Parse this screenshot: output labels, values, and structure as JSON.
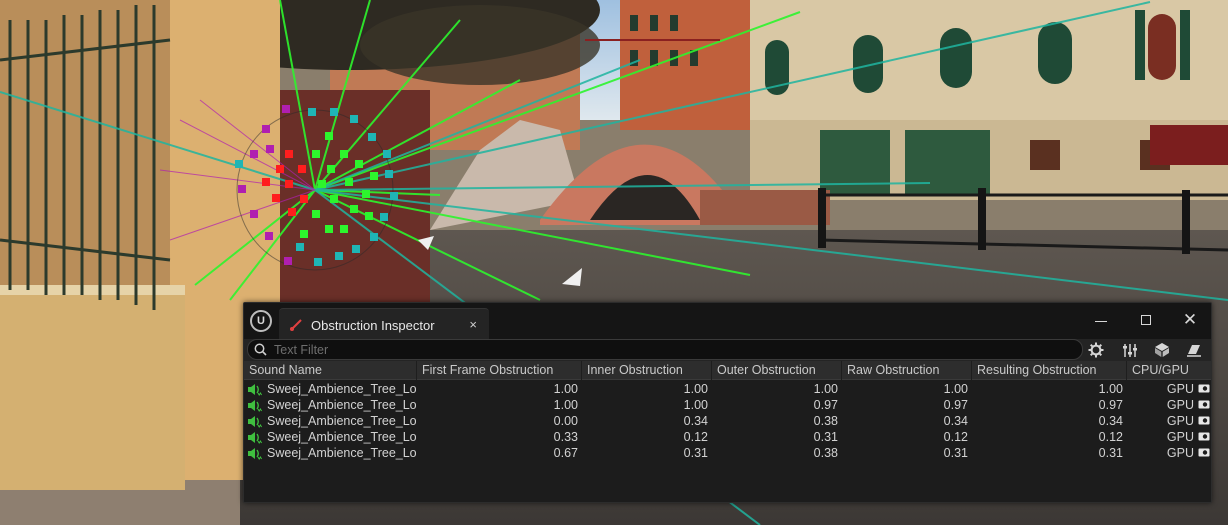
{
  "window": {
    "title": "Obstruction Inspector",
    "tab_close": "×",
    "logo": "U",
    "controls": {
      "close": "✕"
    }
  },
  "toolbar": {
    "search_placeholder": "Text Filter",
    "icons": [
      "search-icon",
      "gear-icon",
      "mixer-sliders-icon",
      "cube-icon",
      "eraser-icon"
    ]
  },
  "table": {
    "columns": [
      "Sound Name",
      "First Frame Obstruction",
      "Inner Obstruction",
      "Outer Obstruction",
      "Raw Obstruction",
      "Resulting Obstruction",
      "CPU/GPU"
    ],
    "rows": [
      {
        "name": "Sweej_Ambience_Tree_Lo",
        "first": "1.00",
        "inner": "1.00",
        "outer": "1.00",
        "raw": "1.00",
        "result": "1.00",
        "proc": "GPU"
      },
      {
        "name": "Sweej_Ambience_Tree_Lo",
        "first": "1.00",
        "inner": "1.00",
        "outer": "0.97",
        "raw": "0.97",
        "result": "0.97",
        "proc": "GPU"
      },
      {
        "name": "Sweej_Ambience_Tree_Lo",
        "first": "0.00",
        "inner": "0.34",
        "outer": "0.38",
        "raw": "0.34",
        "result": "0.34",
        "proc": "GPU"
      },
      {
        "name": "Sweej_Ambience_Tree_Lo",
        "first": "0.33",
        "inner": "0.12",
        "outer": "0.31",
        "raw": "0.12",
        "result": "0.12",
        "proc": "GPU"
      },
      {
        "name": "Sweej_Ambience_Tree_Lo",
        "first": "0.67",
        "inner": "0.31",
        "outer": "0.38",
        "raw": "0.31",
        "result": "0.31",
        "proc": "GPU"
      }
    ]
  },
  "colors": {
    "window_bg": "#1b1b1b",
    "header_bg": "#2d2d2d",
    "speaker_icon": "#3fbf3f",
    "ray_green": "#2df52d",
    "ray_teal": "#1fb5a0",
    "sphere_red": "#ff1e1e",
    "sphere_magenta": "#b01fb0",
    "sphere_cyan": "#1fb5b5"
  }
}
